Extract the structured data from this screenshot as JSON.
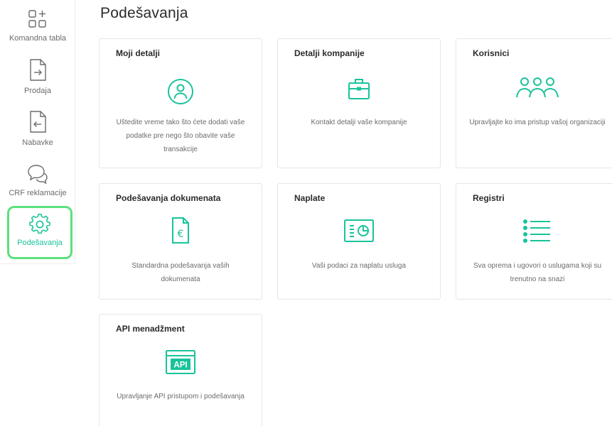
{
  "page": {
    "title": "Podešavanja"
  },
  "colors": {
    "accent": "#19c39a",
    "highlight": "#5ce07c",
    "icon_gray": "#6b6b6b"
  },
  "sidebar": {
    "items": [
      {
        "label": "Komandna tabla",
        "icon": "dashboard-grid-plus-icon"
      },
      {
        "label": "Prodaja",
        "icon": "document-arrow-right-icon"
      },
      {
        "label": "Nabavke",
        "icon": "document-arrow-left-icon"
      },
      {
        "label": "CRF reklamacije",
        "icon": "chat-bubbles-icon"
      },
      {
        "label": "Podešavanja",
        "icon": "gear-icon",
        "active": true
      }
    ]
  },
  "cards": [
    {
      "title": "Moji detalji",
      "description": "Uštedite vreme tako što ćete dodati vaše podatke pre nego što obavite vaše transakcije",
      "icon": "user-circle-icon"
    },
    {
      "title": "Detalji kompanije",
      "description": "Kontakt detalji vaše kompanije",
      "icon": "briefcase-icon"
    },
    {
      "title": "Korisnici",
      "description": "Upravljajte ko ima pristup vašoj organizaciji",
      "icon": "users-group-icon"
    },
    {
      "title": "Podešavanja dokumenata",
      "description": "Standardna podešavanja vaših dokumenata",
      "icon": "document-euro-icon"
    },
    {
      "title": "Naplate",
      "description": "Vaši podaci za naplatu usluga",
      "icon": "invoice-chart-icon"
    },
    {
      "title": "Registri",
      "description": "Sva oprema i ugovori o uslugama koji su trenutno na snazi",
      "icon": "list-icon"
    },
    {
      "title": "API menadžment",
      "description": "Upravljanje API pristupom i podešavanja",
      "icon": "api-window-icon",
      "icon_text": "API"
    }
  ]
}
